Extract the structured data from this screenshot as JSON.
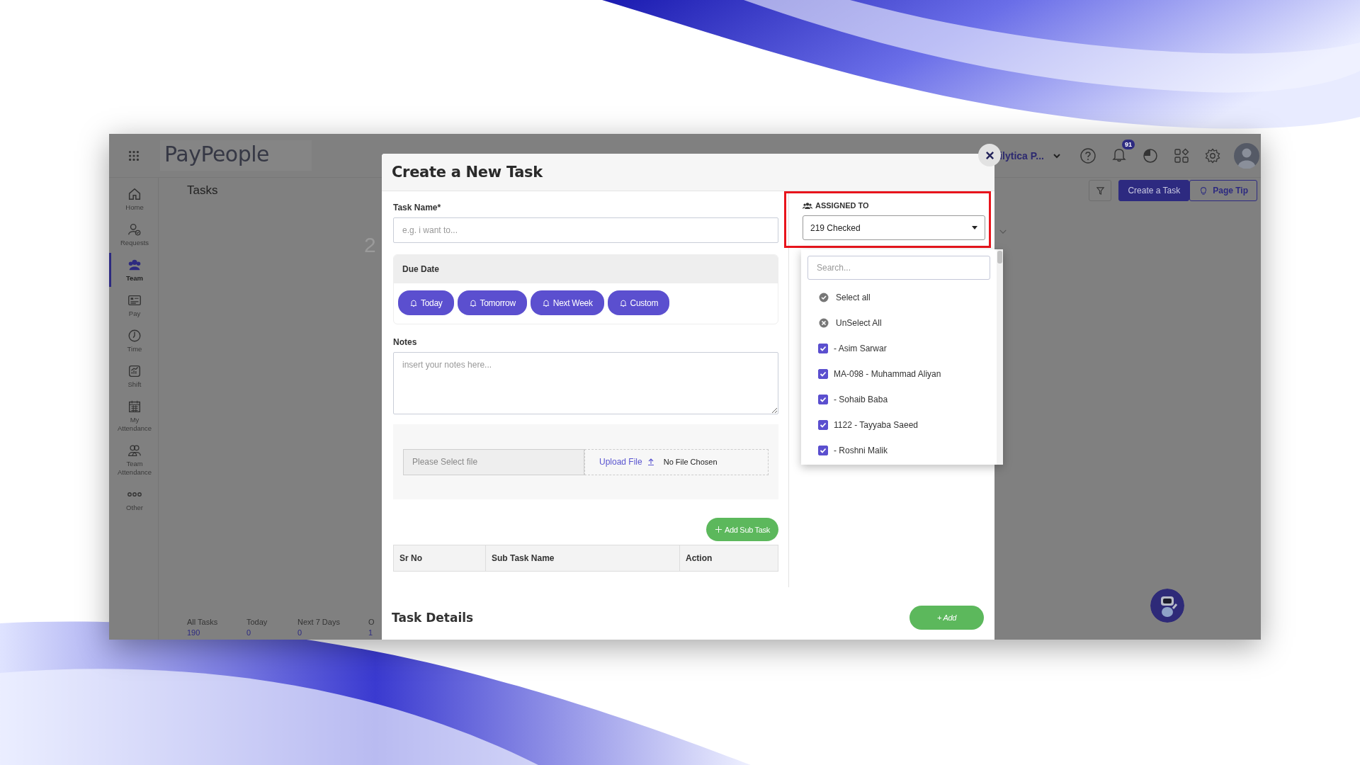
{
  "app": {
    "logo": "PayPeople",
    "company": "ilytica P...",
    "notification_count": "91",
    "page_title": "Tasks",
    "stat_number": "2",
    "header_buttons": [
      {
        "label": "Create a Task",
        "kind": "primary"
      },
      {
        "label": "Page Tip",
        "kind": "tip"
      }
    ],
    "stats": [
      {
        "label": "All Tasks",
        "value": "190"
      },
      {
        "label": "Today",
        "value": "0"
      },
      {
        "label": "Next 7 Days",
        "value": "0"
      },
      {
        "label": "O",
        "value": "1"
      }
    ]
  },
  "sidebar": {
    "items": [
      {
        "label": "Home",
        "selected": false
      },
      {
        "label": "Requests",
        "selected": false
      },
      {
        "label": "Team",
        "selected": true
      },
      {
        "label": "Pay",
        "selected": false
      },
      {
        "label": "Time",
        "selected": false
      },
      {
        "label": "Shift",
        "selected": false
      },
      {
        "label": "My Attendance",
        "selected": false
      },
      {
        "label": "Team Attendance",
        "selected": false
      },
      {
        "label": "Other",
        "selected": false
      }
    ]
  },
  "modal": {
    "title": "Create a New Task",
    "task_name": {
      "label": "Task Name*",
      "placeholder": "e.g. i want to..."
    },
    "due_date": {
      "label": "Due Date",
      "options": [
        {
          "label": "Today"
        },
        {
          "label": "Tomorrow"
        },
        {
          "label": "Next Week"
        },
        {
          "label": "Custom"
        }
      ]
    },
    "notes": {
      "label": "Notes",
      "placeholder": "insert your notes here..."
    },
    "attachment": {
      "placeholder": "Please Select file",
      "upload_label": "Upload File",
      "status": "No File Chosen"
    },
    "add_subtask_label": "Add Sub Task",
    "subtask_columns": [
      "Sr No",
      "Sub Task Name",
      "Action"
    ],
    "task_details": {
      "title": "Task Details",
      "add_label": "+ Add"
    },
    "assigned": {
      "label": "ASSIGNED TO",
      "value": "219 Checked",
      "search_placeholder": "Search...",
      "options": [
        {
          "label": "Select all",
          "kind": "select-all"
        },
        {
          "label": "UnSelect All",
          "kind": "unselect-all"
        },
        {
          "label": "- Asim Sarwar",
          "kind": "member",
          "checked": true
        },
        {
          "label": "MA-098 - Muhammad Aliyan",
          "kind": "member",
          "checked": true
        },
        {
          "label": "- Sohaib Baba",
          "kind": "member",
          "checked": true
        },
        {
          "label": "1122 - Tayyaba Saeed",
          "kind": "member",
          "checked": true
        },
        {
          "label": "- Roshni Malik",
          "kind": "member",
          "checked": true
        }
      ]
    }
  }
}
